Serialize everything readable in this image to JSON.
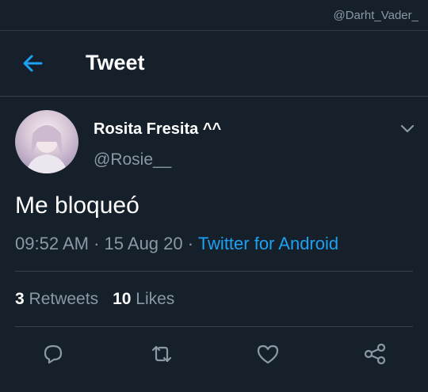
{
  "watermark": "@Darht_Vader_",
  "header": {
    "title": "Tweet",
    "back_icon": "arrow-left-icon"
  },
  "author": {
    "display_name": "Rosita Fresita ^^",
    "username": "@Rosie__"
  },
  "tweet": {
    "text": "Me bloqueó",
    "time": "09:52 AM",
    "date": "15 Aug 20",
    "source": "Twitter for Android"
  },
  "stats": {
    "retweets_count": "3",
    "retweets_label": "Retweets",
    "likes_count": "10",
    "likes_label": "Likes"
  },
  "actions": [
    "reply-icon",
    "retweet-icon",
    "like-icon",
    "share-icon"
  ],
  "colors": {
    "background": "#15202b",
    "accent": "#1da1f2",
    "muted": "#8b98a5",
    "divider": "#38444d"
  }
}
